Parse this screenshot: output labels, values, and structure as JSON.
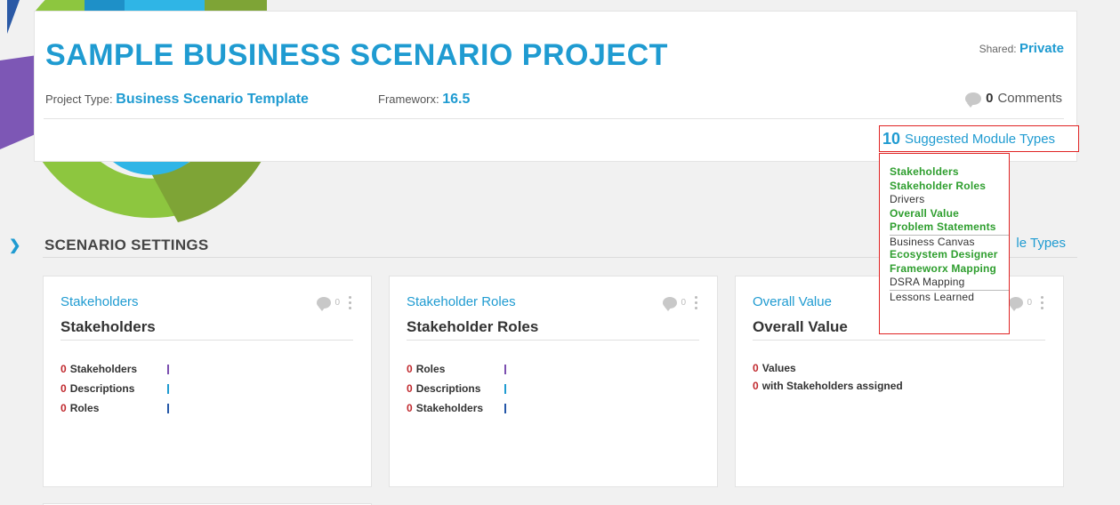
{
  "project": {
    "title": "SAMPLE BUSINESS SCENARIO PROJECT",
    "shared_label": "Shared:",
    "shared_value": "Private",
    "type_label": "Project Type:",
    "type_value": "Business Scenario Template",
    "frameworx_label": "Frameworx:",
    "frameworx_value": "16.5",
    "comments_count": "0",
    "comments_label": "Comments"
  },
  "suggested": {
    "count": "10",
    "label": "Suggested Module Types",
    "items": [
      {
        "label": "Stakeholders",
        "status": "green"
      },
      {
        "label": "Stakeholder Roles",
        "status": "green"
      },
      {
        "label": "Drivers",
        "status": "plain"
      },
      {
        "label": "Overall Value",
        "status": "green"
      },
      {
        "label": "Problem Statements",
        "status": "green"
      },
      {
        "label": "Business Canvas",
        "status": "plain"
      },
      {
        "label": "Ecosystem Designer",
        "status": "green"
      },
      {
        "label": "Frameworx Mapping",
        "status": "green"
      },
      {
        "label": "DSRA Mapping",
        "status": "plain"
      },
      {
        "label": "Lessons Learned",
        "status": "plain"
      }
    ]
  },
  "settings": {
    "title": "SCENARIO SETTINGS",
    "link_partial": "le Types"
  },
  "cards": [
    {
      "kicker": "Stakeholders",
      "title": "Stakeholders",
      "comment_count": "0",
      "stats": [
        {
          "num": "0",
          "label": "Stakeholders",
          "bar_color": "#7b4fb0"
        },
        {
          "num": "0",
          "label": "Descriptions",
          "bar_color": "#1f9bd1"
        },
        {
          "num": "0",
          "label": "Roles",
          "bar_color": "#2457a8"
        }
      ]
    },
    {
      "kicker": "Stakeholder Roles",
      "title": "Stakeholder Roles",
      "comment_count": "0",
      "stats": [
        {
          "num": "0",
          "label": "Roles",
          "bar_color": "#7b4fb0"
        },
        {
          "num": "0",
          "label": "Descriptions",
          "bar_color": "#1f9bd1"
        },
        {
          "num": "0",
          "label": "Stakeholders",
          "bar_color": "#2457a8"
        }
      ]
    },
    {
      "kicker": "Overall Value",
      "title": "Overall Value",
      "comment_count": "0",
      "stats": [
        {
          "num": "0",
          "label": "Values"
        },
        {
          "num": "0",
          "label": "with Stakeholders assigned"
        }
      ]
    }
  ]
}
